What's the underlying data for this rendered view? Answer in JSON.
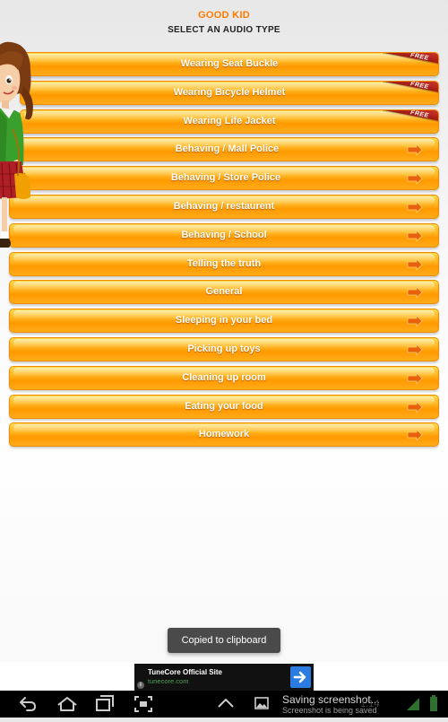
{
  "app": {
    "title": "GOOD KID",
    "subtitle": "SELECT AN AUDIO TYPE"
  },
  "menu": {
    "free_badge": "FREE",
    "items": [
      {
        "label": "Wearing Seat Buckle",
        "free": true
      },
      {
        "label": "Wearing Bicycle Helmet",
        "free": true
      },
      {
        "label": "Wearing Life Jacket",
        "free": true
      },
      {
        "label": "Behaving / Mall Police",
        "free": false
      },
      {
        "label": "Behaving / Store Police",
        "free": false
      },
      {
        "label": "Behaving / restaurent",
        "free": false
      },
      {
        "label": "Behaving / School",
        "free": false
      },
      {
        "label": "Telling the truth",
        "free": false
      },
      {
        "label": "General",
        "free": false
      },
      {
        "label": "Sleeping in your bed",
        "free": false
      },
      {
        "label": "Picking up toys",
        "free": false
      },
      {
        "label": "Cleaning up room",
        "free": false
      },
      {
        "label": "Eating your food",
        "free": false
      },
      {
        "label": "Homework",
        "free": false
      }
    ]
  },
  "toast": {
    "text": "Copied to clipboard"
  },
  "ad": {
    "title": "TuneCore Official Site",
    "url": "tunecore.com",
    "info_glyph": "i"
  },
  "status_bar": {
    "notification_title": "Saving screenshot...",
    "notification_subtitle": "Screenshot is being saved",
    "time": "1:14"
  },
  "colors": {
    "title_orange": "#ff7a00",
    "button_orange": "#ff9900",
    "ribbon_red": "#c22a20",
    "ad_button_blue": "#2b7be0"
  },
  "icons": {
    "menu_arrow": "arrow-right-icon",
    "nav_back": "back-icon",
    "nav_home": "home-icon",
    "nav_recent": "recent-apps-icon",
    "nav_screenshot": "screenshot-icon",
    "nav_menu_up": "chevron-up-icon",
    "notification": "image-icon",
    "wifi": "wifi-icon",
    "battery": "battery-icon"
  }
}
